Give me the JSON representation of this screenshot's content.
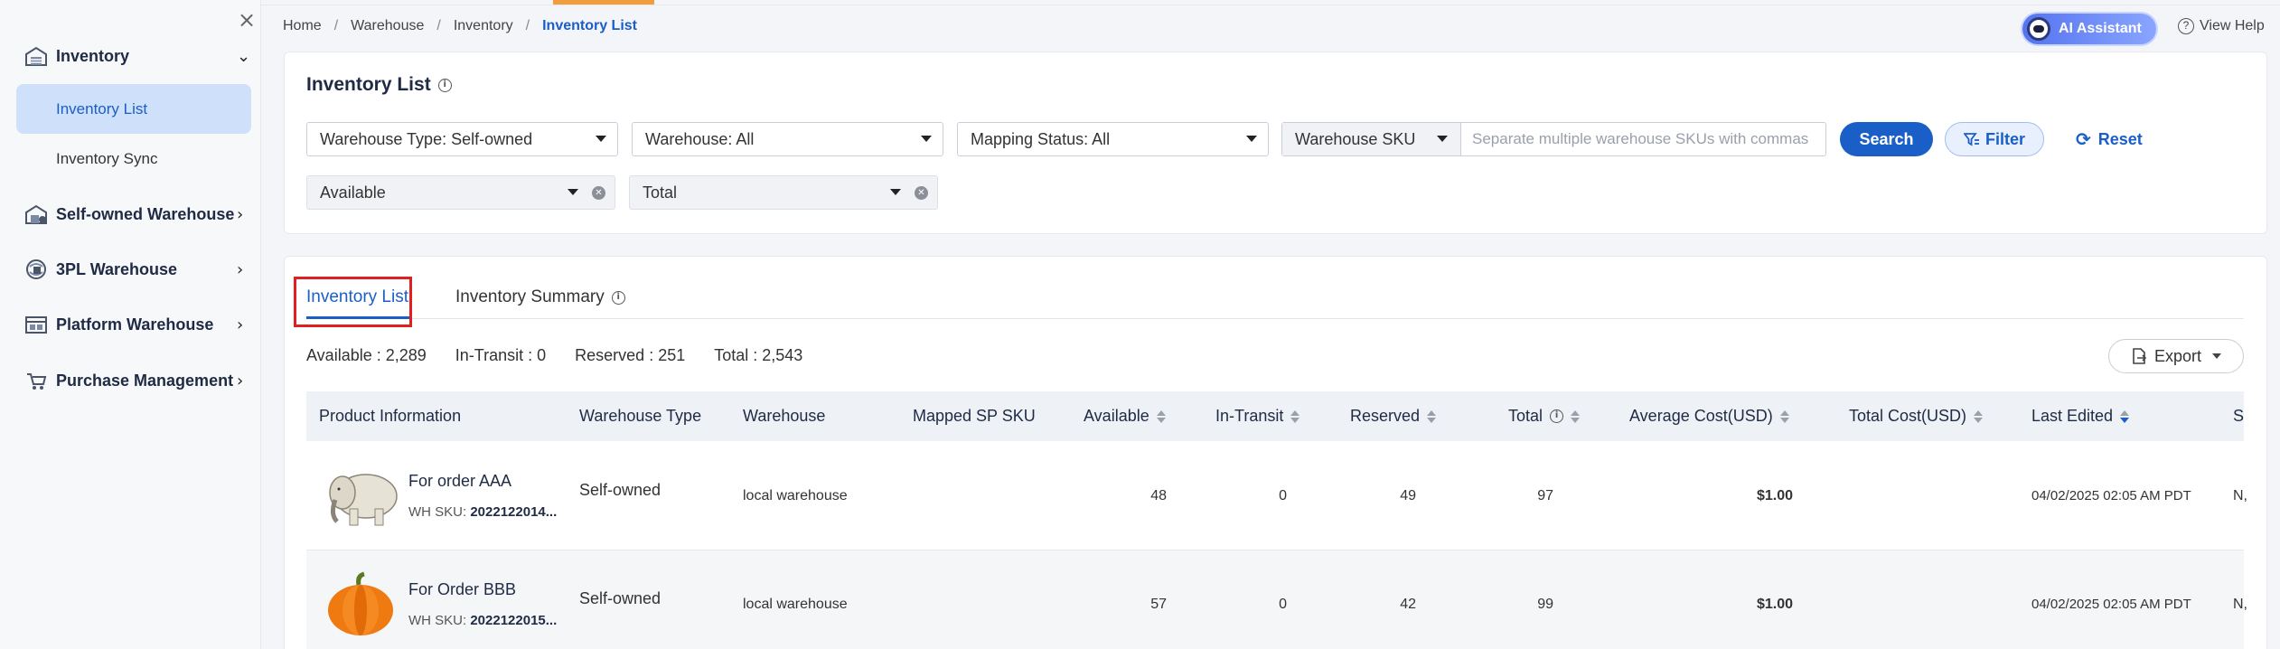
{
  "sidebar": {
    "groups": [
      {
        "label": "Inventory",
        "icon": "warehouse-icon",
        "expanded": true
      },
      {
        "label": "Self-owned Warehouse",
        "icon": "self-owned-warehouse-icon"
      },
      {
        "label": "3PL Warehouse",
        "icon": "3pl-warehouse-icon"
      },
      {
        "label": "Platform Warehouse",
        "icon": "platform-warehouse-icon"
      },
      {
        "label": "Purchase Management",
        "icon": "purchase-icon"
      }
    ],
    "sub_items": [
      {
        "label": "Inventory List",
        "active": true
      },
      {
        "label": "Inventory Sync",
        "active": false
      }
    ],
    "close_glyph": "×"
  },
  "breadcrumb": [
    "Home",
    "Warehouse",
    "Inventory",
    "Inventory List"
  ],
  "header": {
    "ai_label": "AI Assistant",
    "help_label": "View Help"
  },
  "page": {
    "title": "Inventory List"
  },
  "filters": {
    "warehouse_type": "Warehouse Type: Self-owned",
    "warehouse": "Warehouse: All",
    "mapping_status": "Mapping Status: All",
    "sku_type": "Warehouse SKU",
    "sku_placeholder": "Separate multiple warehouse SKUs with commas",
    "available": "Available",
    "total": "Total",
    "search_label": "Search",
    "filter_label": "Filter",
    "reset_label": "Reset"
  },
  "tabs": [
    {
      "label": "Inventory List",
      "active": true
    },
    {
      "label": "Inventory Summary",
      "active": false
    }
  ],
  "summary": {
    "available": "Available : 2,289",
    "in_transit": "In-Transit : 0",
    "reserved": "Reserved : 251",
    "total": "Total : 2,543"
  },
  "export_label": "Export",
  "table": {
    "columns": [
      "Product Information",
      "Warehouse Type",
      "Warehouse",
      "Mapped SP SKU",
      "Available",
      "In-Transit",
      "Reserved",
      "Total",
      "Average Cost(USD)",
      "Total Cost(USD)",
      "Last Edited",
      "S"
    ],
    "rows": [
      {
        "name": "For order AAA",
        "sku_label": "WH SKU:",
        "sku": "2022122014...",
        "image": "elephant",
        "warehouse_type": "Self-owned",
        "warehouse": "local warehouse",
        "mapped": "",
        "available": "48",
        "in_transit": "0",
        "reserved": "49",
        "total": "97",
        "avg_cost": "$1.00",
        "total_cost": "",
        "last_edited": "04/02/2025 02:05 AM PDT",
        "s": "N,"
      },
      {
        "name": "For Order BBB",
        "sku_label": "WH SKU:",
        "sku": "2022122015...",
        "image": "pumpkin",
        "warehouse_type": "Self-owned",
        "warehouse": "local warehouse",
        "mapped": "",
        "available": "57",
        "in_transit": "0",
        "reserved": "42",
        "total": "99",
        "avg_cost": "$1.00",
        "total_cost": "",
        "last_edited": "04/02/2025 02:05 AM PDT",
        "s": "N,"
      }
    ]
  },
  "colors": {
    "accent": "#1a5ec8",
    "highlight": "#e02020",
    "topbar": "#f39c3d"
  }
}
